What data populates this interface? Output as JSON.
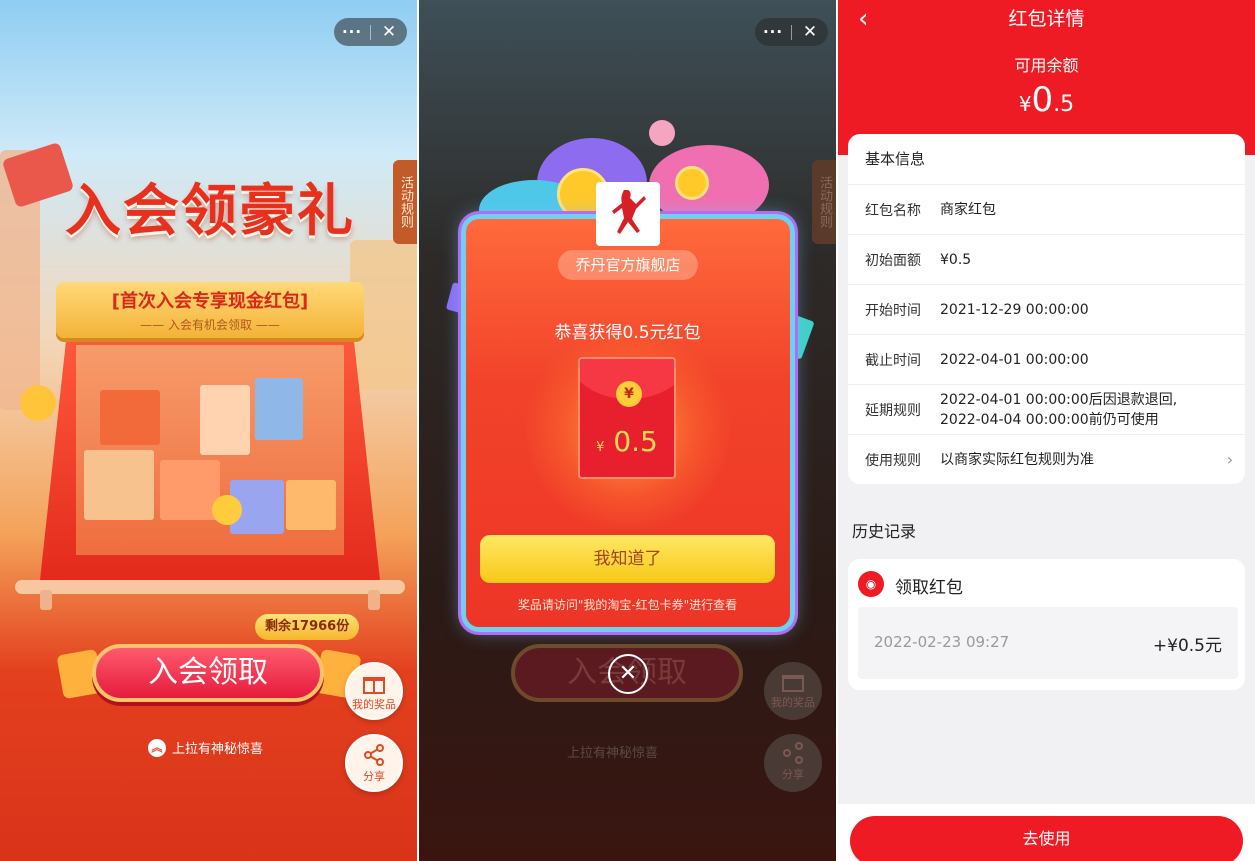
{
  "panel1": {
    "rules_tab": "活动规则",
    "title": "入会领豪礼",
    "ribbon_main": "[首次入会专享现金红包]",
    "ribbon_sub": "—— 入会有机会领取 ——",
    "remain": "剩余17966份",
    "join_button": "入会领取",
    "pull_tip": "上拉有神秘惊喜",
    "my_prizes": "我的奖品",
    "share": "分享"
  },
  "panel2": {
    "rules_tab": "活动规则",
    "store": "乔丹官方旗舰店",
    "congrats": "恭喜获得0.5元红包",
    "envelope_amount": "0.5",
    "envelope_currency": "¥",
    "envelope_coin": "¥",
    "know_button": "我知道了",
    "hint": "奖品请访问\"我的淘宝-红包卡券\"进行查看",
    "ghost_join": "入会领取",
    "pull_tip": "上拉有神秘惊喜",
    "my_prizes": "我的奖品",
    "share": "分享"
  },
  "panel3": {
    "title": "红包详情",
    "balance_label": "可用余额",
    "balance_currency": "¥",
    "balance_int": "0",
    "balance_dec": ".5",
    "info_header": "基本信息",
    "rows": [
      {
        "k": "红包名称",
        "v": "商家红包"
      },
      {
        "k": "初始面额",
        "v": "¥0.5"
      },
      {
        "k": "开始时间",
        "v": "2021-12-29 00:00:00"
      },
      {
        "k": "截止时间",
        "v": "2022-04-01 00:00:00"
      },
      {
        "k": "延期规则",
        "v": "2022-04-01 00:00:00后因退款退回,"
      },
      {
        "k": "使用规则",
        "v": "以商家实际红包规则为准"
      }
    ],
    "extend_rule_line2": "2022-04-04 00:00:00前仍可使用",
    "history_title": "历史记录",
    "history_item": "领取红包",
    "history_date": "2022-02-23 09:27",
    "history_amount": "+¥0.5元",
    "use_button": "去使用"
  },
  "colors": {
    "brand_red": "#ee1b24",
    "gold": "#f7c816"
  },
  "icons": [
    "more-icon",
    "close-icon",
    "gift-icon",
    "share-icon",
    "chevron-up-icon",
    "back-icon",
    "chevron-right-icon",
    "coin-icon"
  ]
}
